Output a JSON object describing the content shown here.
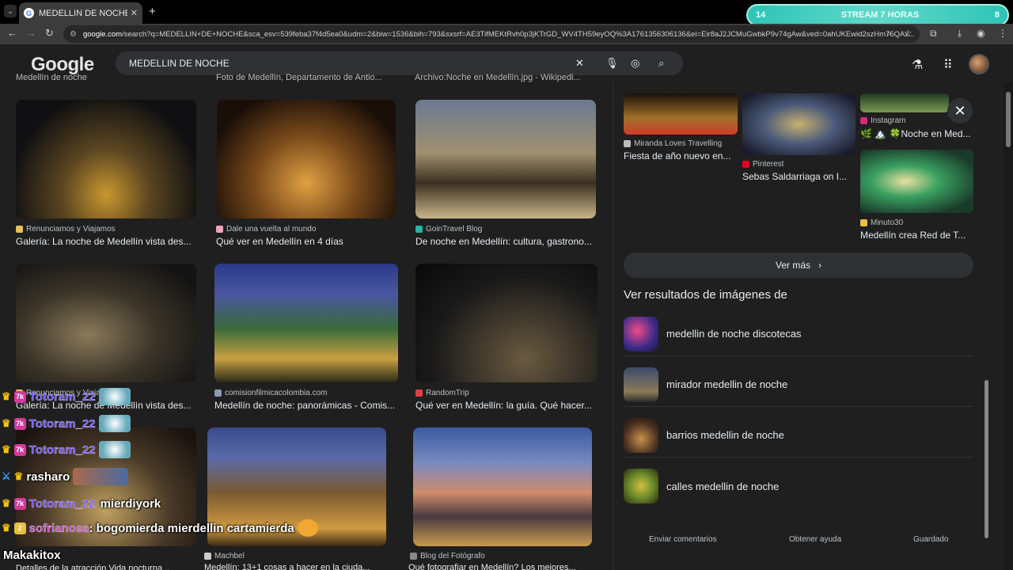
{
  "browser": {
    "tab_title": "MEDELLIN DE NOCHE - Buscar",
    "tab_close": "✕",
    "new_tab": "+",
    "url_host": "google.com",
    "url_path": "/search?q=MEDELLIN+DE+NOCHE&sca_esv=539feba37f4d5ea0&udm=2&biw=1536&bih=793&sxsrf=AE3TifMEKtRvh0p3jKTrGD_WV4TH59eyOQ%3A1761356306136&ei=Eir8aJ2JCMuGwbkP9v74gAw&ved=0ahUKEwid2szHm76QAx..."
  },
  "stream_overlay": {
    "left": "14",
    "label": "STREAM 7 HORAS",
    "right": "8"
  },
  "header": {
    "logo": "Google",
    "search_value": "MEDELLIN DE NOCHE"
  },
  "results": {
    "partial_captions": [
      "Medellín de noche",
      "Foto de Medellín, Departamento de Antio...",
      "Archivo:Noche en Medellín.jpg - Wikipedi..."
    ],
    "row1": [
      {
        "source": "Renunciamos y Viajamos",
        "caption": "Galería: La noche de Medellín vista des..."
      },
      {
        "source": "Dale una vuelta al mundo",
        "caption": "Qué ver en Medellín en 4 días"
      },
      {
        "source": "GoinTravel Blog",
        "caption": "De noche en Medellín: cultura, gastrono..."
      }
    ],
    "row2": [
      {
        "source": "Renunciamos y Viajamos",
        "caption": "Galería: La noche de Medellín vista des..."
      },
      {
        "source": "comisionfilmicacolombia.com",
        "caption": "Medellín de noche: panorámicas - Comis..."
      },
      {
        "source": "RandomTrip",
        "caption": "Qué ver en Medellín: la guía. Qué hacer..."
      }
    ],
    "row3": [
      {
        "source": "Machbel",
        "caption": "Medellín: 13+1 cosas a hacer en la ciuda..."
      },
      {
        "source": "Blog del Fotógrafo",
        "caption": "Qué fotografiar en Medellín? Los mejores..."
      }
    ],
    "row3_partial_caption": "Detalles de la atracción Vida nocturna..."
  },
  "panel": {
    "items": [
      {
        "source": "Miranda Loves Travelling",
        "caption": "Fiesta de año nuevo en..."
      },
      {
        "source": "Pinterest",
        "caption": "Sebas Saldarriaga on I..."
      },
      {
        "source": "Instagram",
        "caption": "🌿 🏔️ 🍀Noche en Med..."
      },
      {
        "source": "Minuto30",
        "caption": "Medellín crea Red de T..."
      }
    ],
    "ver_mas": "Ver más",
    "related_title": "Ver resultados de imágenes de",
    "related": [
      "medellin de noche discotecas",
      "mirador medellin de noche",
      "barrios medellin de noche",
      "calles medellin de noche"
    ],
    "footer": [
      "Enviar comentarios",
      "Obtener ayuda",
      "Guardado"
    ]
  },
  "chat": [
    {
      "user": "Totoram_22",
      "message": ""
    },
    {
      "user": "Totoram_22",
      "message": ""
    },
    {
      "user": "Totoram_22",
      "message": ""
    },
    {
      "user": "rasharo",
      "message": ""
    },
    {
      "user": "Totoram_22",
      "message": "mierdiyork"
    },
    {
      "user": "sofrianosa",
      "message": ": bogomierda mierdellin cartamierda"
    }
  ],
  "streamer_nick": "Makakitox"
}
